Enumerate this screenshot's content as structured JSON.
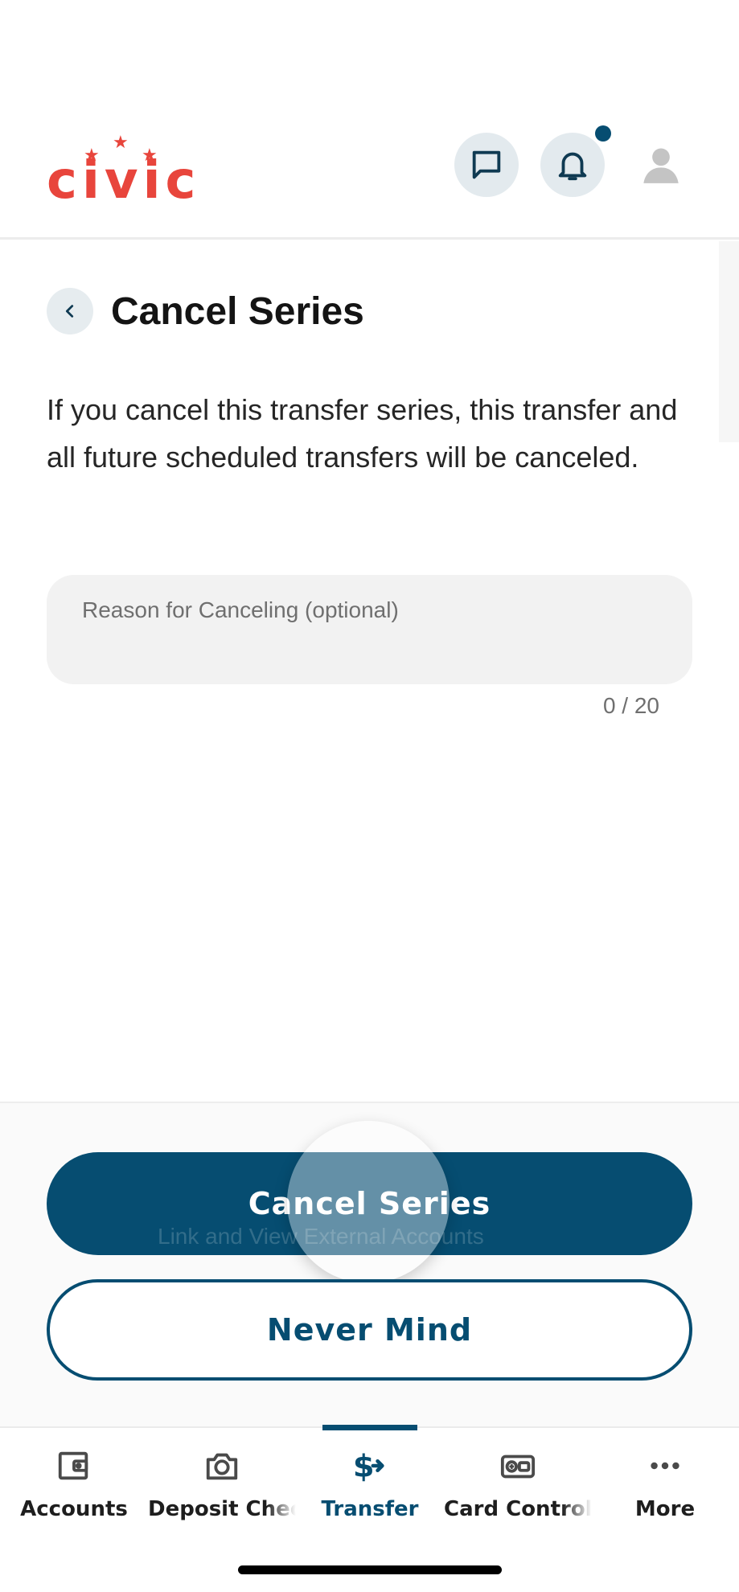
{
  "header": {
    "logo_text": "civic",
    "messages_icon": "chat-bubble-icon",
    "notifications_icon": "bell-icon",
    "profile_icon": "person-icon"
  },
  "page": {
    "back_icon": "chevron-left-icon",
    "title": "Cancel Series",
    "description": "If you cancel this transfer series, this transfer and all future scheduled transfers will be canceled.",
    "reason_placeholder": "Reason for Canceling (optional)",
    "reason_value": "",
    "char_count": "0 / 20"
  },
  "actions": {
    "confirm_label": "Cancel Series",
    "dismiss_label": "Never Mind",
    "underlay_link": "Link and View External Accounts"
  },
  "tabs": [
    {
      "label": "Accounts",
      "icon": "wallet-icon",
      "active": false
    },
    {
      "label": "Deposit Chec",
      "icon": "camera-icon",
      "active": false
    },
    {
      "label": "Transfer",
      "icon": "dollar-arrow-icon",
      "active": true
    },
    {
      "label": "Card Control",
      "icon": "card-icon",
      "active": false
    },
    {
      "label": "More",
      "icon": "more-dots-icon",
      "active": false
    }
  ],
  "colors": {
    "brand_red": "#e8453c",
    "primary": "#064d71",
    "surface": "#f2f2f2"
  }
}
